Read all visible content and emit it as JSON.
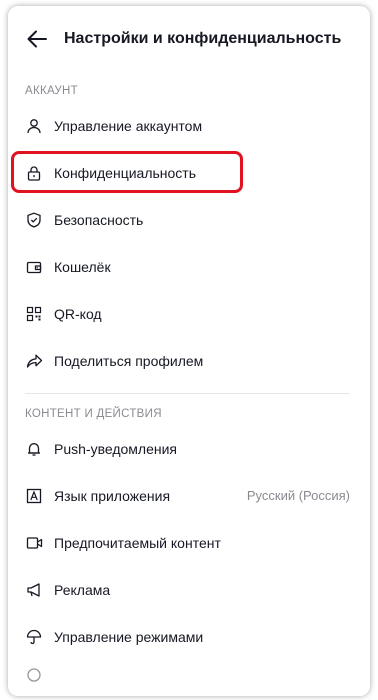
{
  "header": {
    "title": "Настройки и конфиденциальность"
  },
  "section_account": {
    "label": "АККАУНТ",
    "items": [
      {
        "label": "Управление аккаунтом",
        "icon": "person-icon"
      },
      {
        "label": "Конфиденциальность",
        "icon": "lock-icon"
      },
      {
        "label": "Безопасность",
        "icon": "shield-icon"
      },
      {
        "label": "Кошелёк",
        "icon": "wallet-icon"
      },
      {
        "label": "QR-код",
        "icon": "qr-code-icon"
      },
      {
        "label": "Поделиться профилем",
        "icon": "share-icon"
      }
    ]
  },
  "section_content": {
    "label": "КОНТЕНТ И ДЕЙСТВИЯ",
    "items": [
      {
        "label": "Push-уведомления",
        "icon": "bell-icon"
      },
      {
        "label": "Язык приложения",
        "value": "Русский (Россия)",
        "icon": "language-icon"
      },
      {
        "label": "Предпочитаемый контент",
        "icon": "video-icon"
      },
      {
        "label": "Реклама",
        "icon": "megaphone-icon"
      },
      {
        "label": "Управление режимами",
        "icon": "umbrella-icon"
      }
    ]
  },
  "colors": {
    "highlight": "#e0121f",
    "text": "#161823",
    "muted": "#8a8b91"
  }
}
